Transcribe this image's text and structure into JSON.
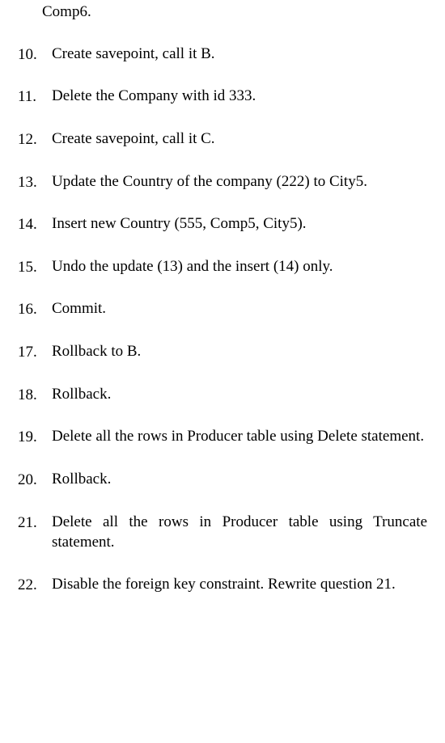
{
  "continuation": "Comp6.",
  "items": [
    {
      "num": "10.",
      "text": "Create savepoint, call it B."
    },
    {
      "num": "11.",
      "text": "Delete the Company with id 333."
    },
    {
      "num": "12.",
      "text": "Create savepoint, call it C."
    },
    {
      "num": "13.",
      "text": "Update the Country of the company (222) to City5."
    },
    {
      "num": "14.",
      "text": "Insert new Country (555, Comp5, City5)."
    },
    {
      "num": "15.",
      "text": "Undo the update (13) and the insert (14) only."
    },
    {
      "num": "16.",
      "text": "Commit."
    },
    {
      "num": "17.",
      "text": "Rollback to B."
    },
    {
      "num": "18.",
      "text": "Rollback."
    },
    {
      "num": "19.",
      "text": "Delete all the rows in Producer table using Delete statement."
    },
    {
      "num": "20.",
      "text": "Rollback."
    },
    {
      "num": "21.",
      "text": "Delete all the rows in Producer table using Truncate statement."
    },
    {
      "num": "22.",
      "text": "Disable the foreign key constraint. Rewrite question 21."
    }
  ]
}
